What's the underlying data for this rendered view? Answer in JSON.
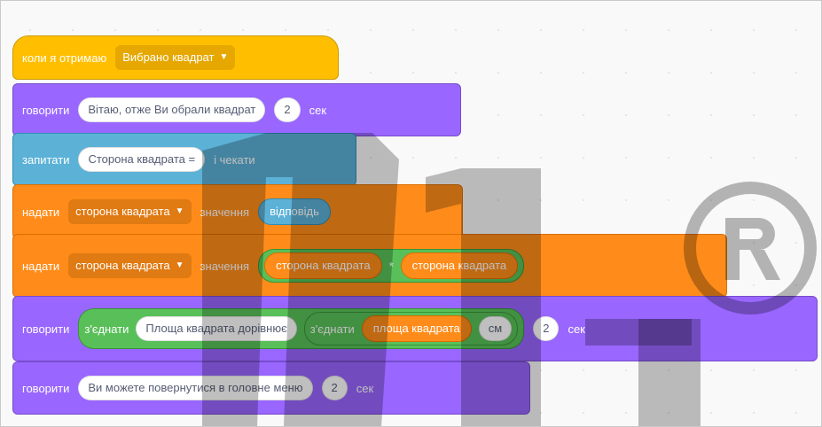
{
  "blocks": {
    "when_clicked": {
      "label": "коли я отримаю",
      "dropdown": "Вибрано квадрат"
    },
    "say1": {
      "label": "говорити",
      "text": "Вітаю, отже Ви обрали квадрат",
      "secs": "2",
      "unit": "сек"
    },
    "ask": {
      "label": "запитати",
      "text": "Сторона квадрата =",
      "suffix": "і чекати"
    },
    "set1": {
      "label": "надати",
      "variable": "сторона квадрата",
      "value_label": "значення",
      "reporter": "відповідь"
    },
    "set2": {
      "label": "надати",
      "variable": "сторона квадрата",
      "value_label": "значення",
      "left": "сторона квадрата",
      "operator": "*",
      "right": "сторона квадрата"
    },
    "say2": {
      "label": "говорити",
      "join1": "з'єднати",
      "text1": "Площа квадрата дорівнює",
      "join2": "з'єднати",
      "var": "площа квадрата",
      "text2": "см",
      "secs": "2",
      "unit": "сек"
    },
    "say3": {
      "label": "говорити",
      "text": "Ви можете повернутися в головне меню",
      "secs": "2",
      "unit": "сек"
    }
  },
  "colors": {
    "events": "#ffbf00",
    "looks": "#9966ff",
    "sensing": "#5cb1d6",
    "variables": "#ff8c1a",
    "operators": "#59c059"
  }
}
